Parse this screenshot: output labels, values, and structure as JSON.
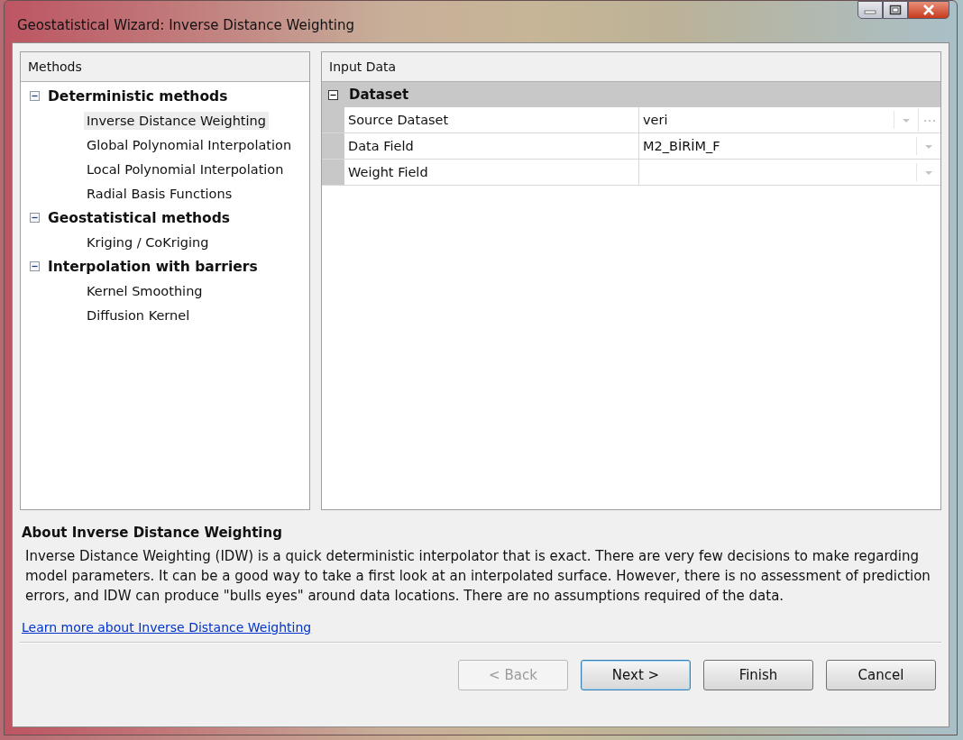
{
  "window": {
    "title": "Geostatistical Wizard: Inverse Distance Weighting"
  },
  "methods": {
    "header": "Methods",
    "groups": [
      {
        "label": "Deterministic methods",
        "expanded": true,
        "children": [
          {
            "label": "Inverse Distance Weighting",
            "selected": true
          },
          {
            "label": "Global Polynomial Interpolation",
            "selected": false
          },
          {
            "label": "Local Polynomial Interpolation",
            "selected": false
          },
          {
            "label": "Radial Basis Functions",
            "selected": false
          }
        ]
      },
      {
        "label": "Geostatistical methods",
        "expanded": true,
        "children": [
          {
            "label": "Kriging / CoKriging",
            "selected": false
          }
        ]
      },
      {
        "label": "Interpolation with barriers",
        "expanded": true,
        "children": [
          {
            "label": "Kernel Smoothing",
            "selected": false
          },
          {
            "label": "Diffusion Kernel",
            "selected": false
          }
        ]
      }
    ]
  },
  "input_data": {
    "header": "Input Data",
    "category": {
      "label": "Dataset",
      "expanded": true
    },
    "rows": [
      {
        "label": "Source Dataset",
        "value": "veri",
        "kind": "browse"
      },
      {
        "label": "Data Field",
        "value": "M2_BİRİM_F",
        "kind": "dropdown"
      },
      {
        "label": "Weight Field",
        "kind": "dropdown"
      }
    ]
  },
  "about": {
    "title": "About Inverse Distance Weighting",
    "text": "Inverse Distance Weighting (IDW) is a quick deterministic interpolator that is exact. There are very few decisions to make regarding model parameters. It can be a good way to take a first look at an interpolated surface. However, there is no assessment of prediction errors, and IDW can produce \"bulls eyes\" around data locations. There are no assumptions required of the data.",
    "link": "Learn more about Inverse Distance Weighting"
  },
  "buttons": [
    {
      "label": "< Back",
      "disabled": true,
      "default": false
    },
    {
      "label": "Next >",
      "disabled": false,
      "default": true
    },
    {
      "label": "Finish",
      "disabled": false,
      "default": false
    },
    {
      "label": "Cancel",
      "disabled": false,
      "default": false
    }
  ]
}
